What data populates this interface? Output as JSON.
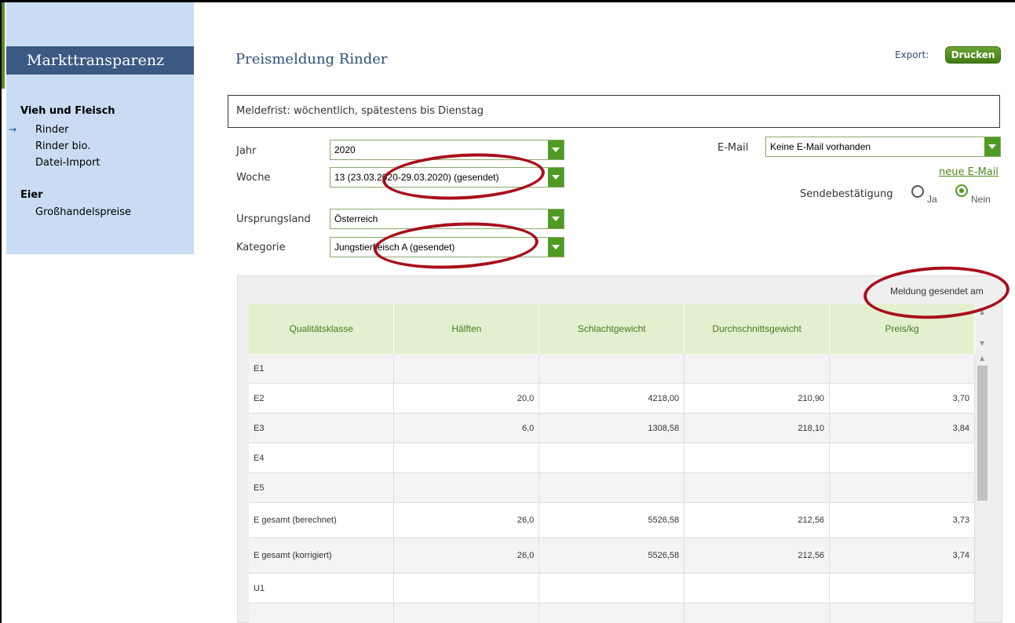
{
  "sidebar": {
    "title": "Markttransparenz",
    "sections": [
      {
        "label": "Vieh und Fleisch",
        "items": [
          {
            "label": "Rinder",
            "active": true
          },
          {
            "label": "Rinder bio."
          },
          {
            "label": "Datei-Import"
          }
        ]
      },
      {
        "label": "Eier",
        "items": [
          {
            "label": "Großhandelspreise"
          }
        ]
      }
    ]
  },
  "header": {
    "title": "Preismeldung Rinder",
    "export_label": "Export:",
    "print_button": "Drucken"
  },
  "notice": "Meldefrist: wöchentlich, spätestens bis Dienstag",
  "form": {
    "jahr": {
      "label": "Jahr",
      "value": "2020"
    },
    "woche": {
      "label": "Woche",
      "value": "13 (23.03.2020-29.03.2020) (gesendet)"
    },
    "ursprungsland": {
      "label": "Ursprungsland",
      "value": "Österreich"
    },
    "kategorie": {
      "label": "Kategorie",
      "value": "Jungstierfleisch A (gesendet)"
    },
    "email": {
      "label": "E-Mail",
      "value": "Keine E-Mail vorhanden",
      "new_link": "neue E-Mail"
    },
    "sendebestaetigung": {
      "label": "Sendebestätigung",
      "options": [
        "Ja",
        "Nein"
      ],
      "selected": "Nein"
    }
  },
  "table": {
    "sent_label": "Meldung gesendet am",
    "columns": [
      "Qualitätsklasse",
      "Hälften",
      "Schlachtgewicht",
      "Durchschnittsgewicht",
      "Preis/kg"
    ],
    "rows": [
      [
        "E1",
        "",
        "",
        "",
        ""
      ],
      [
        "E2",
        "20,0",
        "4218,00",
        "210,90",
        "3,70"
      ],
      [
        "E3",
        "6,0",
        "1308,58",
        "218,10",
        "3,84"
      ],
      [
        "E4",
        "",
        "",
        "",
        ""
      ],
      [
        "E5",
        "",
        "",
        "",
        ""
      ],
      [
        "E gesamt (berechnet)",
        "26,0",
        "5526,58",
        "212,56",
        "3,73"
      ],
      [
        "E gesamt (korrigiert)",
        "26,0",
        "5526,58",
        "212,56",
        "3,74"
      ],
      [
        "U1",
        "",
        "",
        "",
        ""
      ],
      [
        "",
        "",
        "",
        "",
        ""
      ]
    ]
  },
  "colors": {
    "accent_green": "#4f9a22",
    "sidebar_bg": "#c9dcf3",
    "sidebar_title_bg": "#3a5a84",
    "annotation_red": "#a80f1b"
  }
}
